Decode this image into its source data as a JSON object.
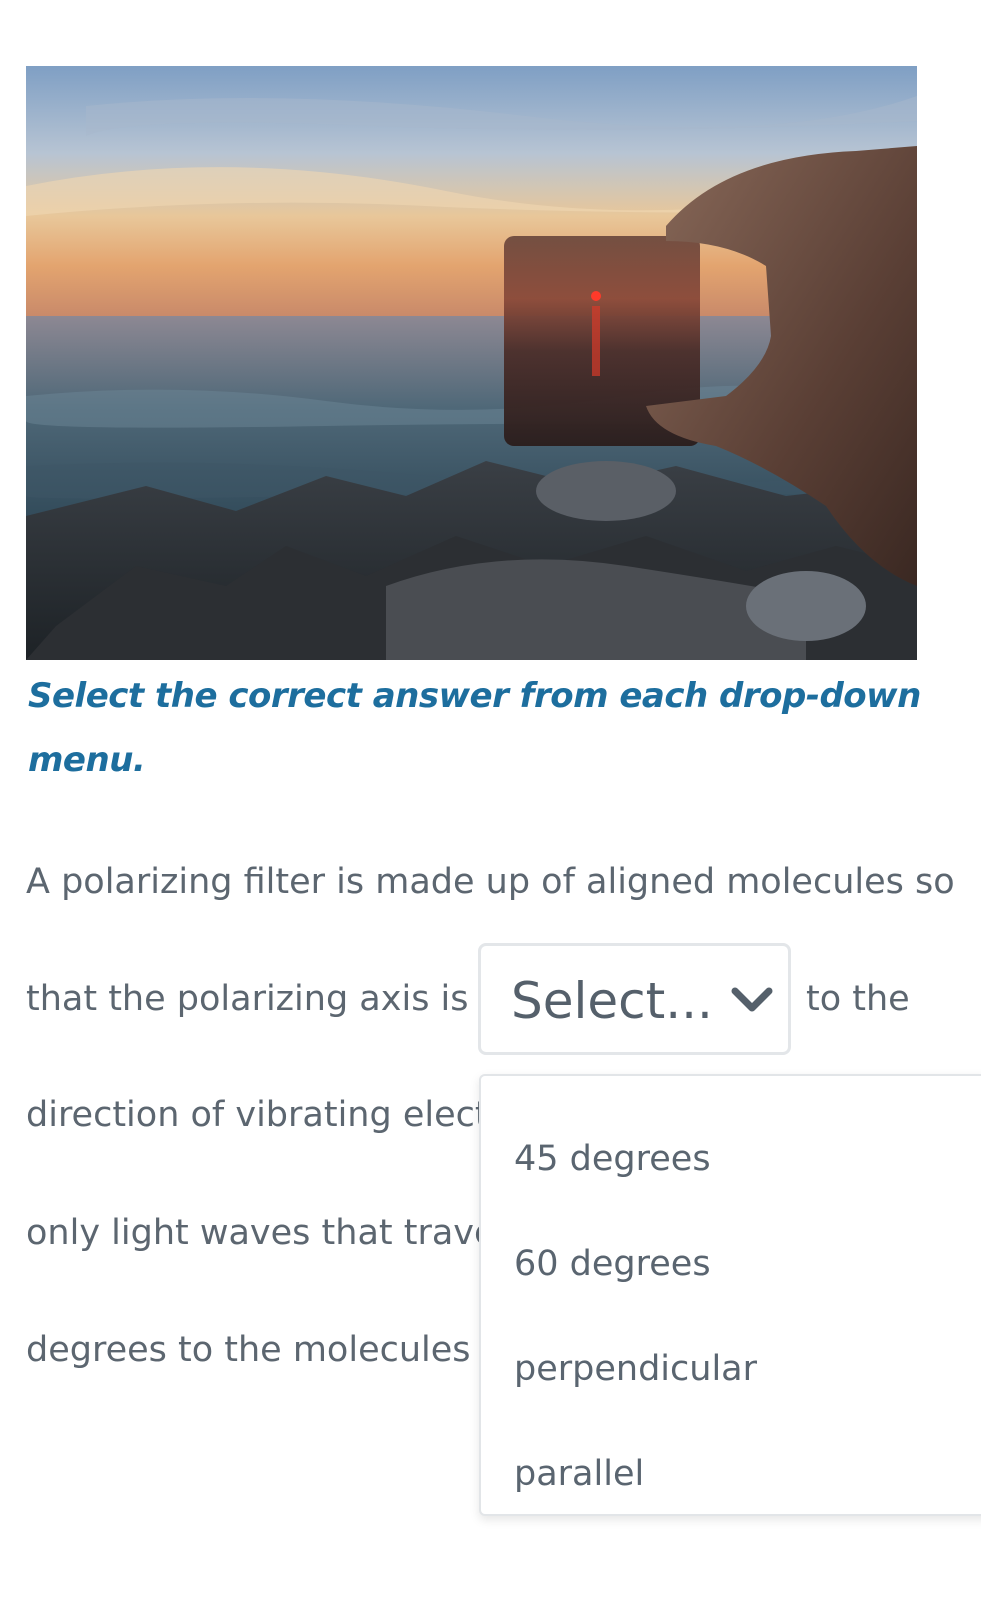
{
  "image": {
    "icon": "polarizing-filter-sunset-photo"
  },
  "instruction": "Select the correct answer from each drop-down menu.",
  "passage": {
    "line1": "A polarizing filter is made up of aligned molecules so",
    "line2_before": "that the polarizing axis is",
    "line2_after": "to the",
    "line3": "direction of vibrating elect",
    "line4": "only light waves that trave",
    "line5": "degrees to the molecules a"
  },
  "select": {
    "value": "Select...",
    "icon": "chevron-down-icon"
  },
  "dropdown": {
    "options": [
      "45 degrees",
      "60 degrees",
      "perpendicular",
      "parallel"
    ]
  },
  "colors": {
    "instruction": "#1d6e9e",
    "body_text": "#5c6670",
    "border": "#e3e6e9"
  }
}
